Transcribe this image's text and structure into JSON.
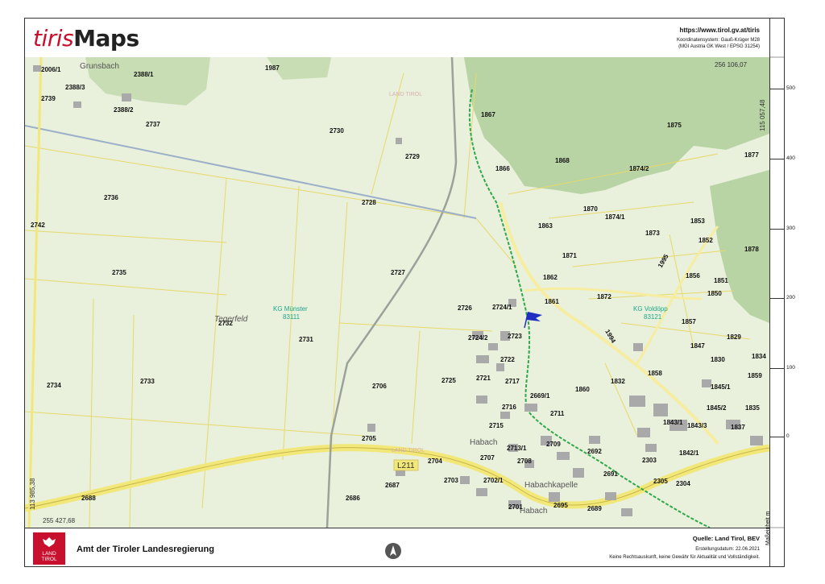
{
  "header": {
    "logo_part1": "tiris",
    "logo_part2": "Maps",
    "url": "https://www.tirol.gv.at/tiris",
    "coord_line1": "Koordinatensystem: Gauß-Krüger M28",
    "coord_line2": "(MGI Austria GK West / EPSG 31254)"
  },
  "map": {
    "corner_top_right": "256 106,07",
    "corner_right_vertical": "115 057,48",
    "corner_bottom_left": "255 427,68",
    "corner_left_vertical": "113 985,38",
    "colors": {
      "meadow": "#e9f0dc",
      "forest": "#b8d4a4",
      "parcel": "#e8d96a",
      "road": "#f2e87a",
      "building": "#a9a9a9",
      "stream": "#2fa84a",
      "flag": "#1f2fbf",
      "district": "#1aa88a"
    },
    "places": [
      {
        "name": "place-grunsbach",
        "text": "Grunsbach"
      },
      {
        "name": "place-tegerfeld",
        "text": "Tegerfeld"
      },
      {
        "name": "place-habach",
        "text": "Habach"
      },
      {
        "name": "place-habachkapelle",
        "text": "Habachkapelle"
      },
      {
        "name": "place-habach-2",
        "text": "Habach"
      }
    ],
    "districts": [
      {
        "line1": "KG Münster",
        "line2": "83111"
      },
      {
        "line1": "KG Voldöpp",
        "line2": "83121"
      }
    ],
    "road_label": "L211",
    "watermark": "LAND TIROL",
    "parcels": [
      "2006/1",
      "2388/1",
      "1987",
      "2388/3",
      "2739",
      "2388/2",
      "2737",
      "2730",
      "2729",
      "2736",
      "2728",
      "2742",
      "2735",
      "2727",
      "2732",
      "2731",
      "2734",
      "2733",
      "2706",
      "2726",
      "2724/1",
      "2724/2",
      "2723",
      "2722",
      "2725",
      "2721",
      "2717",
      "2669/1",
      "2716",
      "2711",
      "2715",
      "2705",
      "2713/1",
      "2709",
      "2704",
      "2707",
      "2708",
      "2703",
      "2702/1",
      "2687",
      "2688",
      "2686",
      "2701",
      "2695",
      "2689",
      "2692",
      "2691",
      "2303",
      "2305",
      "2304",
      "1867",
      "1875",
      "1877",
      "1866",
      "1868",
      "1874/2",
      "1870",
      "1874/1",
      "1863",
      "1853",
      "1873",
      "1852",
      "1878",
      "1871",
      "1995",
      "1862",
      "1856",
      "1851",
      "1861",
      "1872",
      "1850",
      "1994",
      "1857",
      "1829",
      "1847",
      "1834",
      "1830",
      "1858",
      "1859",
      "1832",
      "1860",
      "1845/1",
      "1845/2",
      "1835",
      "1843/1",
      "1843/3",
      "1837",
      "1842/1"
    ]
  },
  "scale": {
    "ticks": [
      "500",
      "400",
      "300",
      "200",
      "100",
      "0"
    ],
    "label": "Maßeinheit m"
  },
  "footer": {
    "coat_line1": "LAND",
    "coat_line2": "TIROL",
    "office": "Amt der Tiroler Landesregierung",
    "quelle": "Quelle: Land Tirol, BEV",
    "erstellung": "Erstellungsdatum:  22.06.2021",
    "disclaimer": "Keine Rechtsauskunft, keine Gewähr für Aktualität und Vollständigkeit."
  }
}
